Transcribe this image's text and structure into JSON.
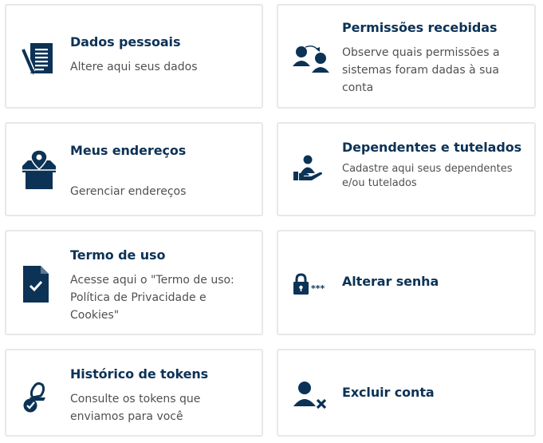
{
  "colors": {
    "accent": "#0c3256",
    "text": "#505050",
    "border": "#e8e8e8"
  },
  "cards": [
    {
      "icon": "document-pen-icon",
      "title": "Dados pessoais",
      "description": "Altere aqui seus dados"
    },
    {
      "icon": "users-transfer-icon",
      "title": "Permissões recebidas",
      "description": "Observe quais permissões a sistemas foram dadas à sua conta"
    },
    {
      "icon": "box-location-pin-icon",
      "title": "Meus endereços",
      "description": "Gerenciar endereços"
    },
    {
      "icon": "hand-person-icon",
      "title": "Dependentes e tutelados",
      "description": "Cadastre aqui seus dependentes e/ou tutelados"
    },
    {
      "icon": "document-check-icon",
      "title": "Termo de uso",
      "description": "Acesse aqui o \"Termo de uso: Política de Privacidade e Cookies\""
    },
    {
      "icon": "lock-password-icon",
      "title": "Alterar senha",
      "icon_text": "***"
    },
    {
      "icon": "stamp-check-icon",
      "title": "Histórico de tokens",
      "description": "Consulte os tokens que enviamos para você"
    },
    {
      "icon": "user-remove-icon",
      "title": "Excluir conta"
    }
  ]
}
